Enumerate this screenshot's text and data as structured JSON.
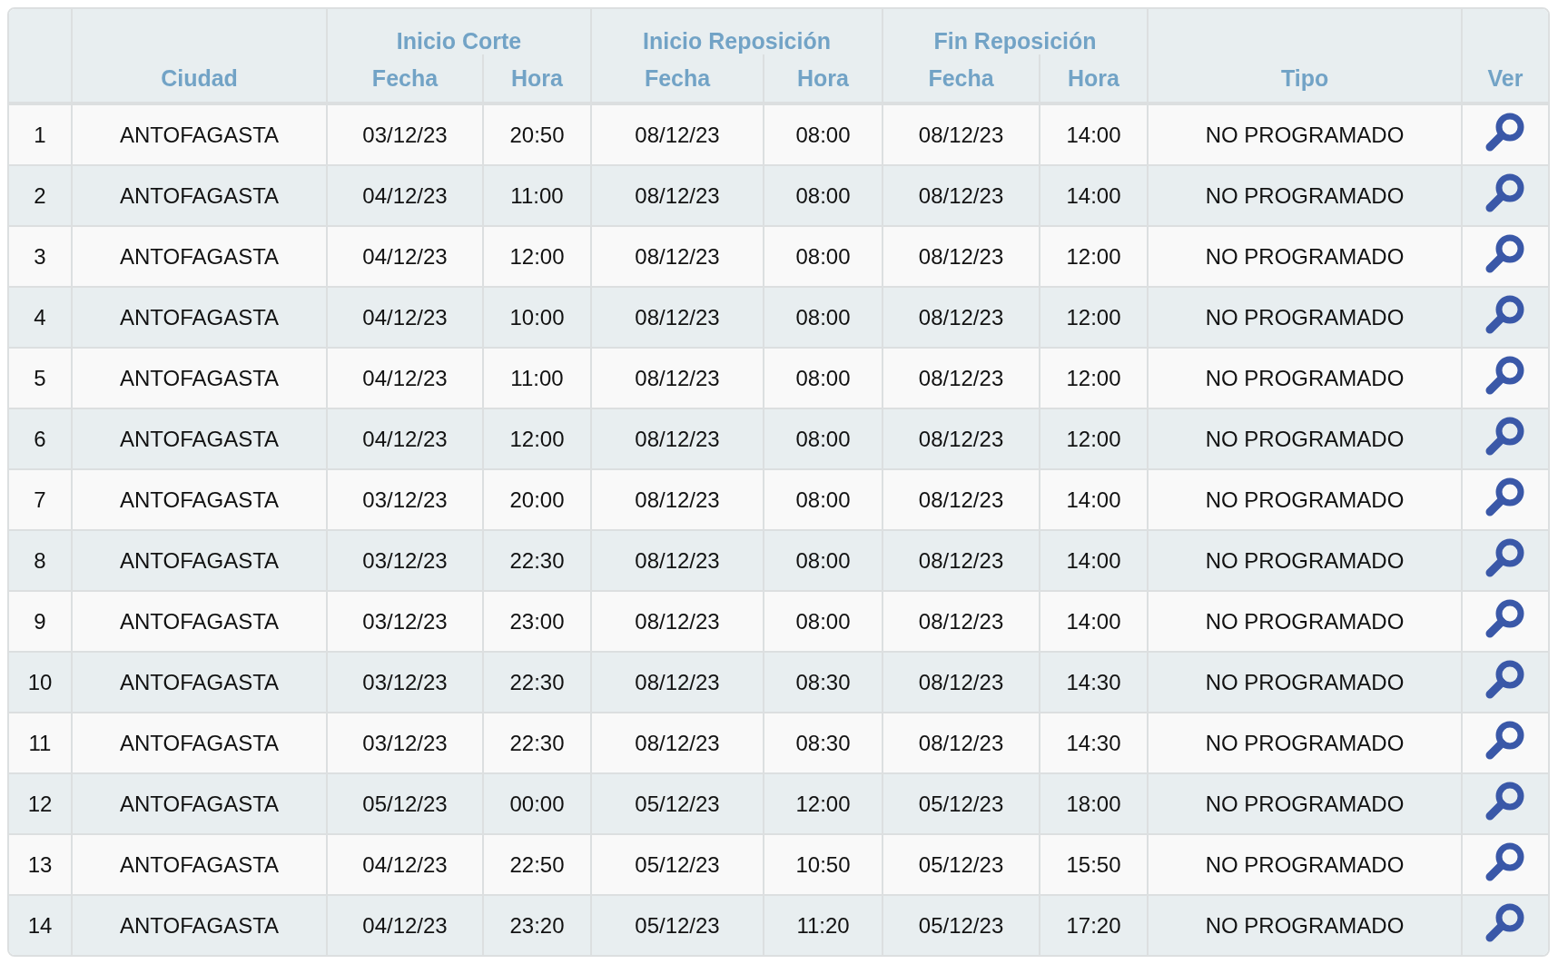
{
  "table": {
    "groups": [
      "Inicio Corte",
      "Inicio Reposición",
      "Fin Reposición"
    ],
    "columns": [
      "",
      "Ciudad",
      "Fecha",
      "Hora",
      "Fecha",
      "Hora",
      "Fecha",
      "Hora",
      "Tipo",
      "Ver"
    ],
    "rows": [
      [
        "1",
        "ANTOFAGASTA",
        "03/12/23",
        "20:50",
        "08/12/23",
        "08:00",
        "08/12/23",
        "14:00",
        "NO PROGRAMADO"
      ],
      [
        "2",
        "ANTOFAGASTA",
        "04/12/23",
        "11:00",
        "08/12/23",
        "08:00",
        "08/12/23",
        "14:00",
        "NO PROGRAMADO"
      ],
      [
        "3",
        "ANTOFAGASTA",
        "04/12/23",
        "12:00",
        "08/12/23",
        "08:00",
        "08/12/23",
        "12:00",
        "NO PROGRAMADO"
      ],
      [
        "4",
        "ANTOFAGASTA",
        "04/12/23",
        "10:00",
        "08/12/23",
        "08:00",
        "08/12/23",
        "12:00",
        "NO PROGRAMADO"
      ],
      [
        "5",
        "ANTOFAGASTA",
        "04/12/23",
        "11:00",
        "08/12/23",
        "08:00",
        "08/12/23",
        "12:00",
        "NO PROGRAMADO"
      ],
      [
        "6",
        "ANTOFAGASTA",
        "04/12/23",
        "12:00",
        "08/12/23",
        "08:00",
        "08/12/23",
        "12:00",
        "NO PROGRAMADO"
      ],
      [
        "7",
        "ANTOFAGASTA",
        "03/12/23",
        "20:00",
        "08/12/23",
        "08:00",
        "08/12/23",
        "14:00",
        "NO PROGRAMADO"
      ],
      [
        "8",
        "ANTOFAGASTA",
        "03/12/23",
        "22:30",
        "08/12/23",
        "08:00",
        "08/12/23",
        "14:00",
        "NO PROGRAMADO"
      ],
      [
        "9",
        "ANTOFAGASTA",
        "03/12/23",
        "23:00",
        "08/12/23",
        "08:00",
        "08/12/23",
        "14:00",
        "NO PROGRAMADO"
      ],
      [
        "10",
        "ANTOFAGASTA",
        "03/12/23",
        "22:30",
        "08/12/23",
        "08:30",
        "08/12/23",
        "14:30",
        "NO PROGRAMADO"
      ],
      [
        "11",
        "ANTOFAGASTA",
        "03/12/23",
        "22:30",
        "08/12/23",
        "08:30",
        "08/12/23",
        "14:30",
        "NO PROGRAMADO"
      ],
      [
        "12",
        "ANTOFAGASTA",
        "05/12/23",
        "00:00",
        "05/12/23",
        "12:00",
        "05/12/23",
        "18:00",
        "NO PROGRAMADO"
      ],
      [
        "13",
        "ANTOFAGASTA",
        "04/12/23",
        "22:50",
        "05/12/23",
        "10:50",
        "05/12/23",
        "15:50",
        "NO PROGRAMADO"
      ],
      [
        "14",
        "ANTOFAGASTA",
        "04/12/23",
        "23:20",
        "05/12/23",
        "11:20",
        "05/12/23",
        "17:20",
        "NO PROGRAMADO"
      ]
    ]
  }
}
